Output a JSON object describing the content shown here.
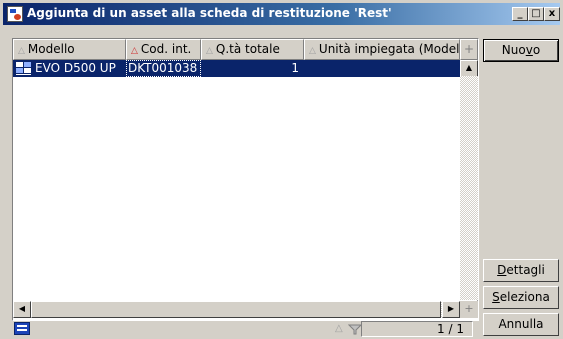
{
  "window": {
    "title": "Aggiunta di un asset alla scheda di restituzione 'Rest'",
    "controls": {
      "minimize": "_",
      "maximize": "□",
      "close": "x"
    }
  },
  "table": {
    "columns": [
      {
        "label": "Modello",
        "sort_color": "gray"
      },
      {
        "label": "Cod. int.",
        "sort_color": "red"
      },
      {
        "label": "Q.tà totale",
        "sort_color": "gray"
      },
      {
        "label": "Unità impiegata (Modello)",
        "sort_color": "gray"
      }
    ],
    "add_column_symbol": "+",
    "rows": [
      {
        "modello": "EVO D500 UP",
        "cod_int": "DKT001038",
        "qta_totale": "1",
        "unita": "",
        "selected": true
      }
    ]
  },
  "status": {
    "counter": "1 / 1"
  },
  "buttons": {
    "nuovo": {
      "pre": "Nuo",
      "accel": "v",
      "post": "o"
    },
    "dettagli": {
      "pre": "",
      "accel": "D",
      "post": "ettagli"
    },
    "seleziona": {
      "pre": "",
      "accel": "S",
      "post": "eleziona"
    },
    "annulla": {
      "label": "Annulla"
    }
  },
  "colors": {
    "selection": "#0a246a",
    "titlebar_start": "#0a246a",
    "titlebar_end": "#a6caf0",
    "window_bg": "#d4d0c8"
  },
  "icons": [
    "app-icon",
    "record-icon",
    "sort-arrow-icon",
    "add-column-icon",
    "table-view-icon",
    "filter-icon"
  ]
}
